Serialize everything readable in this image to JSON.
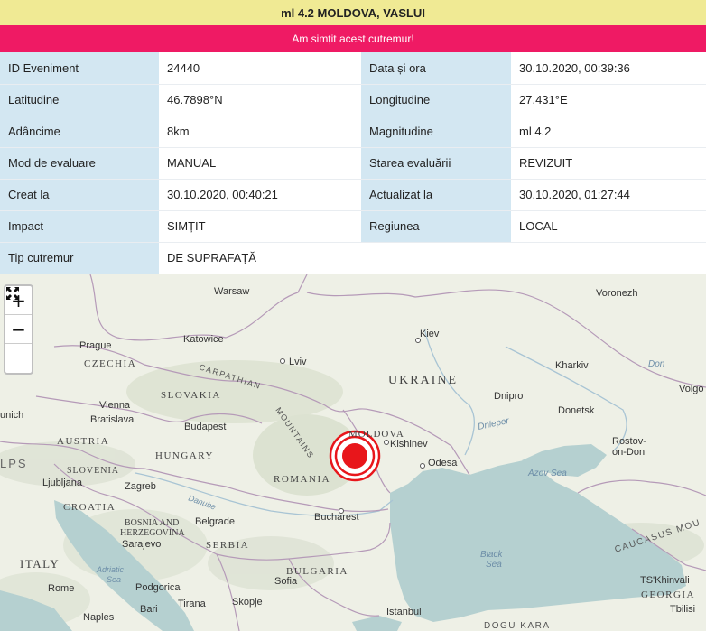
{
  "header": {
    "title": "ml 4.2 MOLDOVA, VASLUI",
    "felt_button": "Am simțit acest cutremur!"
  },
  "details": {
    "rows": [
      {
        "l1": "ID Eveniment",
        "v1": "24440",
        "l2": "Data și ora",
        "v2": "30.10.2020, 00:39:36"
      },
      {
        "l1": "Latitudine",
        "v1": "46.7898°N",
        "l2": "Longitudine",
        "v2": "27.431°E"
      },
      {
        "l1": "Adâncime",
        "v1": "8km",
        "l2": "Magnitudine",
        "v2": "ml 4.2"
      },
      {
        "l1": "Mod de evaluare",
        "v1": "MANUAL",
        "l2": "Starea evaluării",
        "v2": "REVIZUIT"
      },
      {
        "l1": "Creat la",
        "v1": "30.10.2020, 00:40:21",
        "l2": "Actualizat la",
        "v2": "30.10.2020, 01:27:44"
      },
      {
        "l1": "Impact",
        "v1": "SIMȚIT",
        "l2": "Regiunea",
        "v2": "LOCAL"
      },
      {
        "l1": "Tip cutremur",
        "v1": "DE SUPRAFAȚĂ"
      }
    ]
  },
  "map": {
    "zoom_in": "+",
    "zoom_out": "−",
    "fullscreen_icon": "fullscreen-icon",
    "colors": {
      "marker": "#e8161b",
      "water": "#b5d0d0",
      "land": "#eef0e6",
      "border": "#b59ab8"
    },
    "labels": {
      "warsaw": "Warsaw",
      "voronezh": "Voronezh",
      "katowice": "Katowice",
      "kiev": "Kiev",
      "prague": "Prague",
      "czechia": "CZECHIA",
      "lviv": "Lviv",
      "carpathian": "CARPATHIAN",
      "mountains": "MOUNTAINS",
      "ukraine": "UKRAINE",
      "kharkiv": "Kharkiv",
      "don": "Don",
      "volgo": "Volgo",
      "vienna": "Vienna",
      "slovakia": "SLOVAKIA",
      "dnipro": "Dnipro",
      "unich": "unich",
      "bratislava": "Bratislava",
      "donetsk": "Donetsk",
      "budapest": "Budapest",
      "moldova": "MOLDOVA",
      "dnieper": "Dnieper",
      "austria": "AUSTRIA",
      "kishinev": "Kishinev",
      "rostov": "Rostov-",
      "ondon": "on-Don",
      "hungary": "HUNGARY",
      "lps": "LPS",
      "slovenia": "SLOVENIA",
      "odesa": "Odesa",
      "azov": "Azov Sea",
      "ljubljana": "Ljubljana",
      "romania": "ROMANIA",
      "zagreb": "Zagreb",
      "danube": "Danube",
      "croatia": "CROATIA",
      "bucharest": "Bucharest",
      "bosnia": "BOSNIA AND",
      "herzegovina": "HERZEGOVINA",
      "belgrade": "Belgrade",
      "sarajevo": "Sarajevo",
      "serbia": "SERBIA",
      "italy": "ITALY",
      "blacksea1": "Black",
      "blacksea2": "Sea",
      "caucasus": "CAUCASUS MOU",
      "adriatic1": "Adriatic",
      "adriatic2": "Sea",
      "bulgaria": "BULGARIA",
      "sofia": "Sofia",
      "tskhinvali": "TS'Khinvali",
      "rome": "Rome",
      "podgorica": "Podgorica",
      "georgia": "GEORGIA",
      "bari": "Bari",
      "tirana": "Tirana",
      "skopje": "Skopje",
      "tbilisi": "Tbilisi",
      "istanbul": "Istanbul",
      "naples": "Naples",
      "dogu": "DOGU KARA"
    }
  }
}
